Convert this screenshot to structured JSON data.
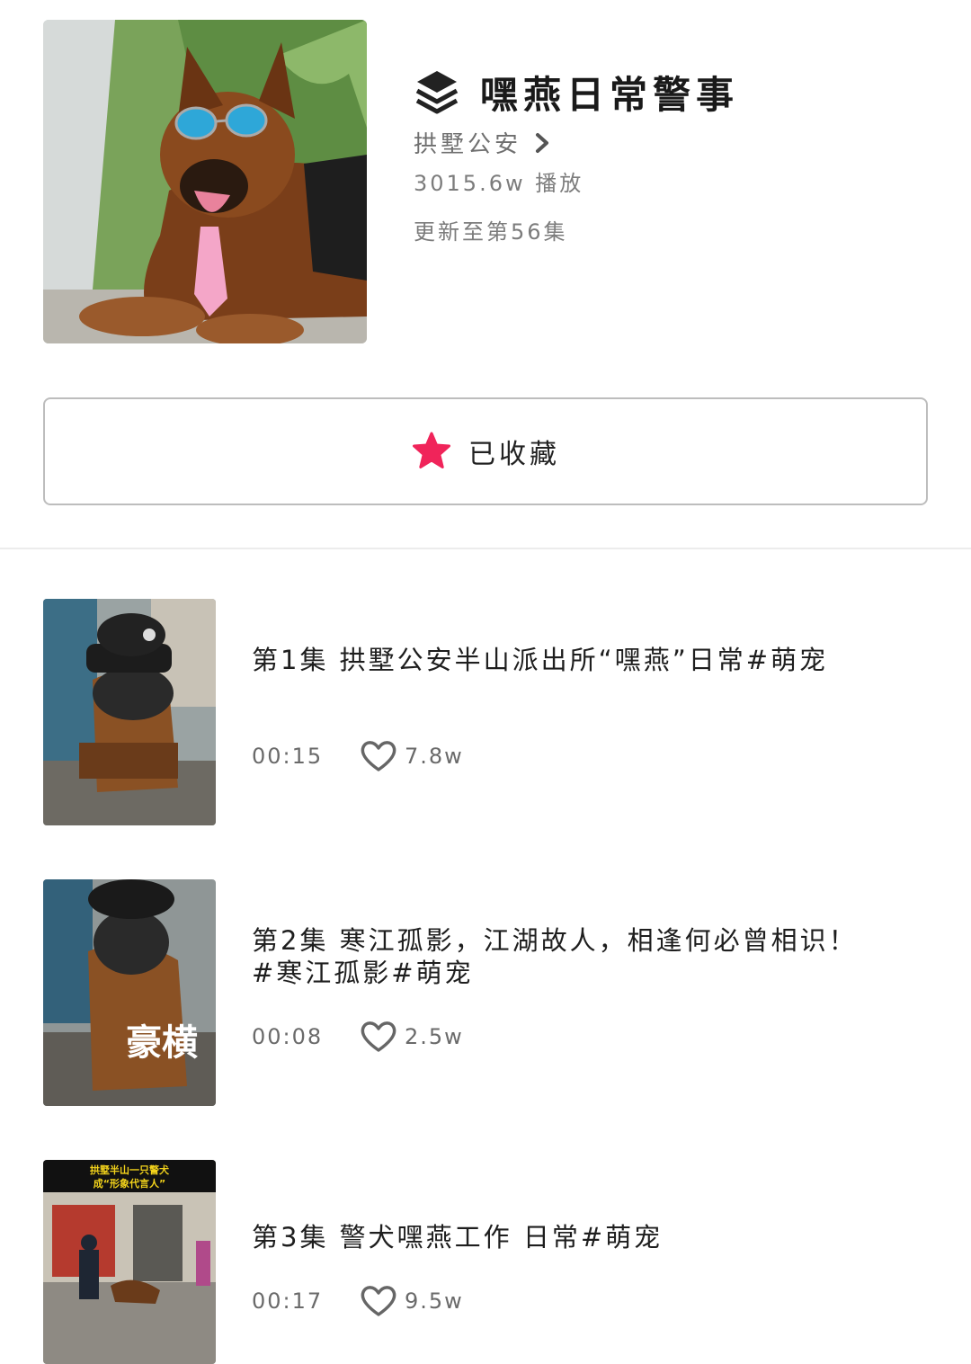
{
  "header": {
    "title": "嘿燕日常警事",
    "author": "拱墅公安",
    "plays": "3015.6w 播放",
    "updated": "更新至第56集",
    "cover_icon": "police-dog-photo"
  },
  "favorite": {
    "label": "已收藏",
    "icon": "star-icon",
    "icon_color": "#f0245a"
  },
  "episodes": [
    {
      "title": "第1集  拱墅公安半山派出所“嘿燕”日常#萌宠",
      "duration": "00:15",
      "likes": "7.8w"
    },
    {
      "title": "第2集  寒江孤影，江湖故人，相逢何必曾相识！#寒江孤影#萌宠",
      "duration": "00:08",
      "likes": "2.5w",
      "thumb_text": "豪横"
    },
    {
      "title": "第3集  警犬嘿燕工作 日常#萌宠",
      "duration": "00:17",
      "likes": "9.5w",
      "thumb_text": [
        "拱墅半山一只警犬",
        "成“形象代言人”"
      ]
    }
  ]
}
